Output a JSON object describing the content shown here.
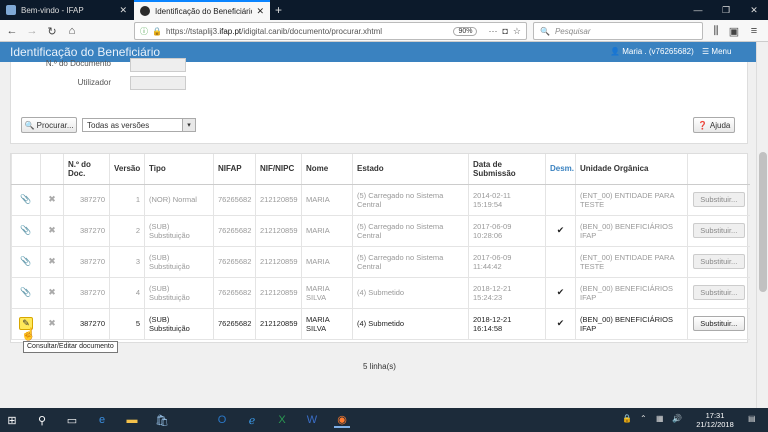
{
  "browser": {
    "tabs": [
      {
        "title": "Bem-vindo - IFAP",
        "active": false
      },
      {
        "title": "Identificação do Beneficiário (A",
        "active": true
      }
    ],
    "url_prefix": "https://tstaplij3.",
    "url_domain": "ifap.pt",
    "url_path": "/idigital.canib/documento/procurar.xhtml",
    "zoom": "90%",
    "search_placeholder": "Pesquisar"
  },
  "app": {
    "page_title": "Identificação do Beneficiário",
    "user": "Maria . (v76265682)",
    "menu_label": "Menu"
  },
  "form": {
    "doc_label": "N.º do Documento",
    "utilizador_label": "Utilizador",
    "procurar_label": "Procurar...",
    "versions_select": "Todas as versões",
    "ajuda_label": "Ajuda"
  },
  "table": {
    "headers": {
      "ndoc": "N.º do Doc.",
      "versao": "Versão",
      "tipo": "Tipo",
      "nifap": "NIFAP",
      "nif": "NIF/NIPC",
      "nome": "Nome",
      "estado": "Estado",
      "data": "Data de Submissão",
      "desm": "Desm.",
      "unidade": "Unidade Orgânica"
    },
    "substituir_label": "Substituir...",
    "rows": [
      {
        "ndoc": "387270",
        "versao": "1",
        "tipo": "(NOR) Normal",
        "nifap": "76265682",
        "nif": "212120859",
        "nome": "MARIA",
        "estado": "(5) Carregado no Sistema Central",
        "data": "2014-02-11 15:19:54",
        "desm": "",
        "unidade": "(ENT_00) ENTIDADE PARA TESTE"
      },
      {
        "ndoc": "387270",
        "versao": "2",
        "tipo": "(SUB) Substituição",
        "nifap": "76265682",
        "nif": "212120859",
        "nome": "MARIA",
        "estado": "(5) Carregado no Sistema Central",
        "data": "2017-06-09 10:28:06",
        "desm": "✔",
        "unidade": "(BEN_00) BENEFICIÁRIOS IFAP"
      },
      {
        "ndoc": "387270",
        "versao": "3",
        "tipo": "(SUB) Substituição",
        "nifap": "76265682",
        "nif": "212120859",
        "nome": "MARIA",
        "estado": "(5) Carregado no Sistema Central",
        "data": "2017-06-09 11:44:42",
        "desm": "",
        "unidade": "(ENT_00) ENTIDADE PARA TESTE"
      },
      {
        "ndoc": "387270",
        "versao": "4",
        "tipo": "(SUB) Substituição",
        "nifap": "76265682",
        "nif": "212120859",
        "nome": "MARIA SILVA",
        "estado": "(4) Submetido",
        "data": "2018-12-21 15:24:23",
        "desm": "✔",
        "unidade": "(BEN_00) BENEFICIÁRIOS IFAP"
      },
      {
        "ndoc": "387270",
        "versao": "5",
        "tipo": "(SUB) Substituição",
        "nifap": "76265682",
        "nif": "212120859",
        "nome": "MARIA SILVA",
        "estado": "(4) Submetido",
        "data": "2018-12-21 16:14:58",
        "desm": "✔",
        "unidade": "(BEN_00) BENEFICIÁRIOS IFAP"
      }
    ]
  },
  "tooltip": "Consultar/Editar documento",
  "row_count": "5 linha(s)",
  "taskbar": {
    "time": "17:31",
    "date": "21/12/2018"
  },
  "icons": {
    "attach": "paperclip-icon",
    "delete": "close-icon",
    "edit": "pencil-icon"
  }
}
